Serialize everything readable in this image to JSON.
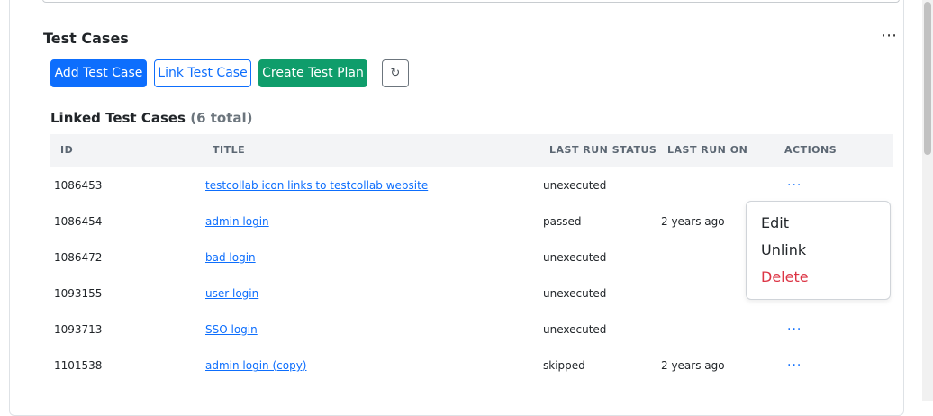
{
  "section": {
    "title": "Test Cases",
    "more_icon": "⋯"
  },
  "toolbar": {
    "add_label": "Add Test Case",
    "link_label": "Link Test Case",
    "create_plan_label": "Create Test Plan",
    "refresh_icon": "↻"
  },
  "linked": {
    "title": "Linked Test Cases",
    "count": "(6 total)"
  },
  "table": {
    "columns": {
      "id": "ID",
      "title": "TITLE",
      "status": "LAST RUN STATUS",
      "run_on": "LAST RUN ON",
      "actions": "ACTIONS"
    },
    "rows": [
      {
        "id": "1086453",
        "title": "testcollab icon links to testcollab website",
        "status": "unexecuted",
        "run_on": "",
        "actions": "···"
      },
      {
        "id": "1086454",
        "title": "admin login",
        "status": "passed",
        "run_on": "2 years ago",
        "actions": ""
      },
      {
        "id": "1086472",
        "title": "bad login",
        "status": "unexecuted",
        "run_on": "",
        "actions": ""
      },
      {
        "id": "1093155",
        "title": "user login",
        "status": "unexecuted",
        "run_on": "",
        "actions": ""
      },
      {
        "id": "1093713",
        "title": "SSO login",
        "status": "unexecuted",
        "run_on": "",
        "actions": "···"
      },
      {
        "id": "1101538",
        "title": "admin login (copy)",
        "status": "skipped",
        "run_on": "2 years ago",
        "actions": "···"
      }
    ]
  },
  "dropdown": {
    "edit": "Edit",
    "unlink": "Unlink",
    "delete": "Delete"
  },
  "colors": {
    "primary": "#0d6efd",
    "success": "#0f9d6b",
    "danger": "#dc3545"
  }
}
